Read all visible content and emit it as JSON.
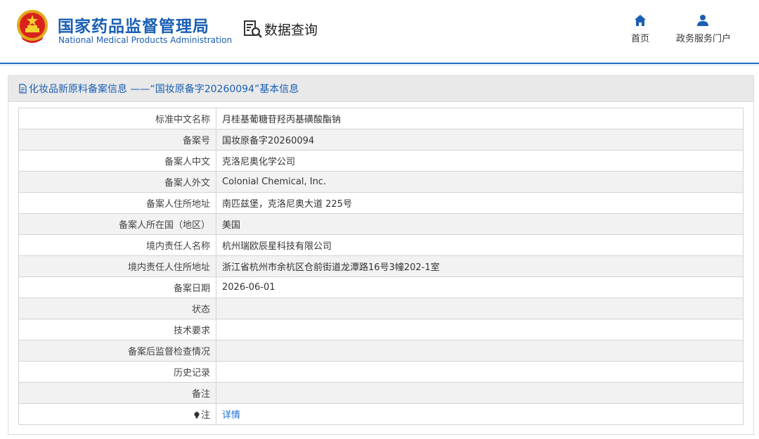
{
  "header": {
    "title_cn": "国家药品监督管理局",
    "title_en": "National Medical Products Administration",
    "data_query_label": "数据查询",
    "nav": [
      {
        "label": "首页",
        "icon": "home-icon"
      },
      {
        "label": "政务服务门户",
        "icon": "user-icon"
      }
    ]
  },
  "panel": {
    "title": "化妆品新原料备案信息 ——“国妆原备字20260094”基本信息",
    "rows": [
      {
        "label": "标准中文名称",
        "value": "月桂基葡糖苷羟丙基磺酸酯钠"
      },
      {
        "label": "备案号",
        "value": "国妆原备字20260094"
      },
      {
        "label": "备案人中文",
        "value": "克洛尼奥化学公司"
      },
      {
        "label": "备案人外文",
        "value": "Colonial Chemical, Inc."
      },
      {
        "label": "备案人住所地址",
        "value": "南匹兹堡，克洛尼奥大道 225号"
      },
      {
        "label": "备案人所在国（地区）",
        "value": "美国"
      },
      {
        "label": "境内责任人名称",
        "value": "杭州瑞欧辰星科技有限公司"
      },
      {
        "label": "境内责任人住所地址",
        "value": "浙江省杭州市余杭区仓前街道龙潭路16号3幢202-1室"
      },
      {
        "label": "备案日期",
        "value": "2026-06-01"
      },
      {
        "label": "状态",
        "value": ""
      },
      {
        "label": "技术要求",
        "value": ""
      },
      {
        "label": "备案后监督检查情况",
        "value": ""
      },
      {
        "label": "历史记录",
        "value": ""
      },
      {
        "label": "备注",
        "value": ""
      }
    ],
    "note": {
      "label": "注",
      "link": "详情",
      "icon": "lightbulb-icon"
    }
  },
  "colors": {
    "brand_blue": "#1a5fb4",
    "link_blue": "#1a6fd6",
    "header_bar": "#1f6fc4"
  }
}
